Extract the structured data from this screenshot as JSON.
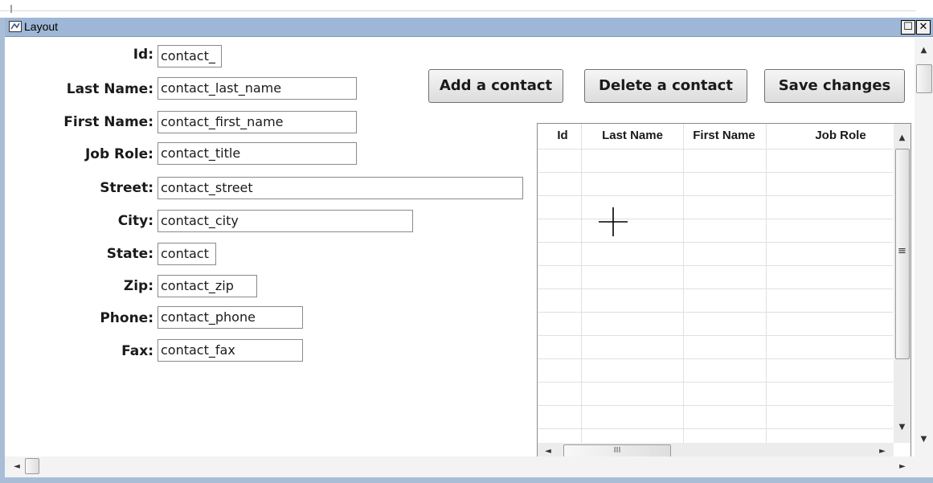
{
  "window": {
    "title": "Layout",
    "maximize_glyph": "☐",
    "close_glyph": "✕"
  },
  "form": {
    "fields": [
      {
        "label": "Id:",
        "value": "contact_"
      },
      {
        "label": "Last Name:",
        "value": "contact_last_name"
      },
      {
        "label": "First Name:",
        "value": "contact_first_name"
      },
      {
        "label": "Job Role:",
        "value": "contact_title"
      },
      {
        "label": "Street:",
        "value": "contact_street"
      },
      {
        "label": "City:",
        "value": "contact_city"
      },
      {
        "label": "State:",
        "value": "contact"
      },
      {
        "label": "Zip:",
        "value": "contact_zip"
      },
      {
        "label": "Phone:",
        "value": "contact_phone"
      },
      {
        "label": "Fax:",
        "value": "contact_fax"
      }
    ]
  },
  "buttons": {
    "add": "Add a contact",
    "delete": "Delete a contact",
    "save": "Save changes"
  },
  "grid": {
    "columns": [
      "Id",
      "Last Name",
      "First Name",
      "Job Role"
    ],
    "hscroll_grip": "III"
  },
  "scroll_glyphs": {
    "up": "▲",
    "down": "▼",
    "left": "◄",
    "right": "►",
    "grip": "≡"
  },
  "icons": {
    "window_icon": "layout-icon",
    "cursor": "crosshair-cursor-icon"
  }
}
